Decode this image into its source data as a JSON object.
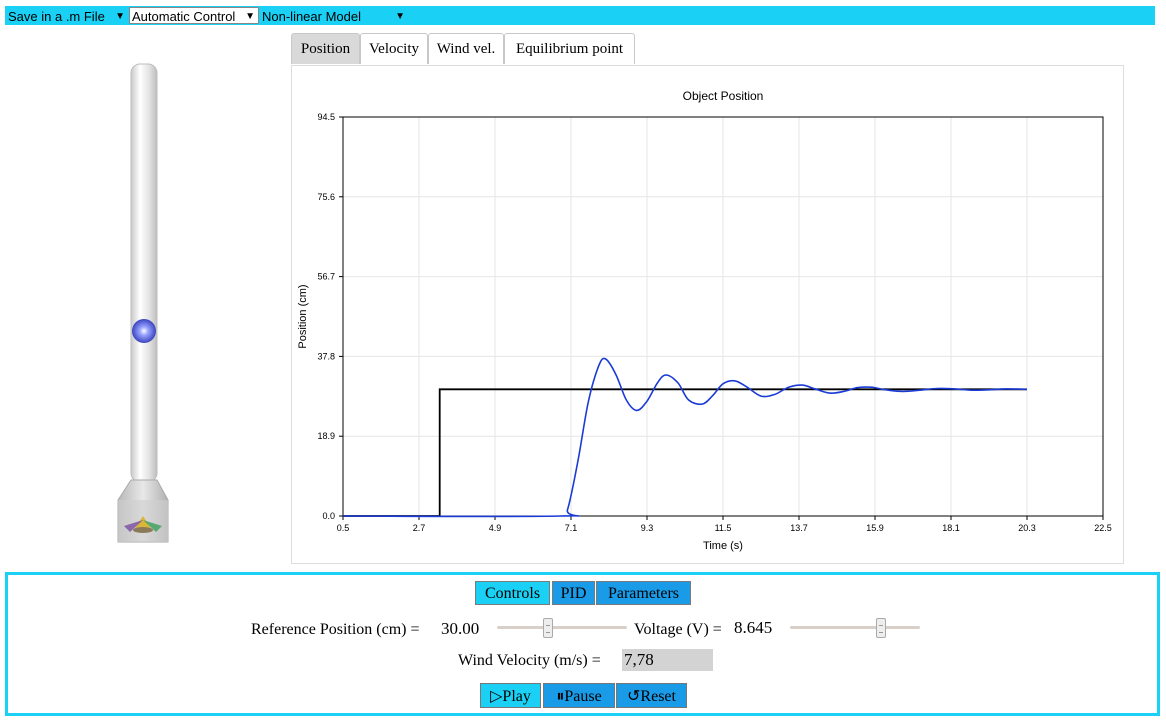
{
  "topbar": {
    "save_menu": "Save in a .m File",
    "control_mode": "Automatic Control",
    "model": "Non-linear Model",
    "accent_color": "#1ad1f5"
  },
  "tabs": [
    "Position",
    "Velocity",
    "Wind vel.",
    "Equilibrium point"
  ],
  "active_tab": "Position",
  "chart_data": {
    "type": "line",
    "title": "Object Position",
    "xlabel": "Time (s)",
    "ylabel": "Position (cm)",
    "xlim": [
      0.5,
      22.5
    ],
    "ylim": [
      0.0,
      94.5
    ],
    "x_ticks": [
      "0.5",
      "2.7",
      "4.9",
      "7.1",
      "9.3",
      "11.5",
      "13.7",
      "15.9",
      "18.1",
      "20.3",
      "22.5"
    ],
    "y_ticks": [
      "0.0",
      "18.9",
      "37.8",
      "56.7",
      "75.6",
      "94.5"
    ],
    "grid": true,
    "series": [
      {
        "color": "#000000",
        "x": [
          0.5,
          3.3,
          3.3,
          20.3
        ],
        "y": [
          0,
          0,
          30,
          30
        ]
      },
      {
        "color": "#1a3bd6",
        "x": [
          0.5,
          6.8,
          7.0,
          7.3,
          7.6,
          7.9,
          8.1,
          8.4,
          8.7,
          9.0,
          9.3,
          9.6,
          9.85,
          10.2,
          10.5,
          10.9,
          11.2,
          11.5,
          11.85,
          12.2,
          12.6,
          13.0,
          13.4,
          13.8,
          14.2,
          14.6,
          15.0,
          15.4,
          15.8,
          16.2,
          16.7,
          17.2,
          17.7,
          18.2,
          18.7,
          19.2,
          19.7,
          20.3
        ],
        "y": [
          0,
          0,
          1.5,
          13,
          27,
          35.5,
          37.2,
          33.5,
          27.5,
          25.0,
          27.2,
          31.5,
          33.4,
          31.5,
          27.5,
          26.5,
          28.5,
          31.3,
          32.0,
          30.5,
          28.4,
          28.8,
          30.5,
          31.0,
          30.0,
          29.1,
          29.5,
          30.4,
          30.5,
          29.9,
          29.5,
          29.8,
          30.2,
          30.1,
          29.8,
          29.9,
          30.1,
          30.0
        ]
      }
    ]
  },
  "controls": {
    "tabs": [
      "Controls",
      "PID",
      "Parameters"
    ],
    "ref_label": "Reference Position (cm) =",
    "ref_value": "30.00",
    "ref_slider_fraction": 0.38,
    "voltage_label": "Voltage (V) =",
    "voltage_value": "8.645",
    "voltage_slider_fraction": 0.72,
    "wind_label": "Wind Velocity (m/s) =",
    "wind_value": "7,78",
    "play_label": "Play",
    "pause_label": "Pause",
    "reset_label": "Reset"
  },
  "ball_position_cm": 30.0
}
